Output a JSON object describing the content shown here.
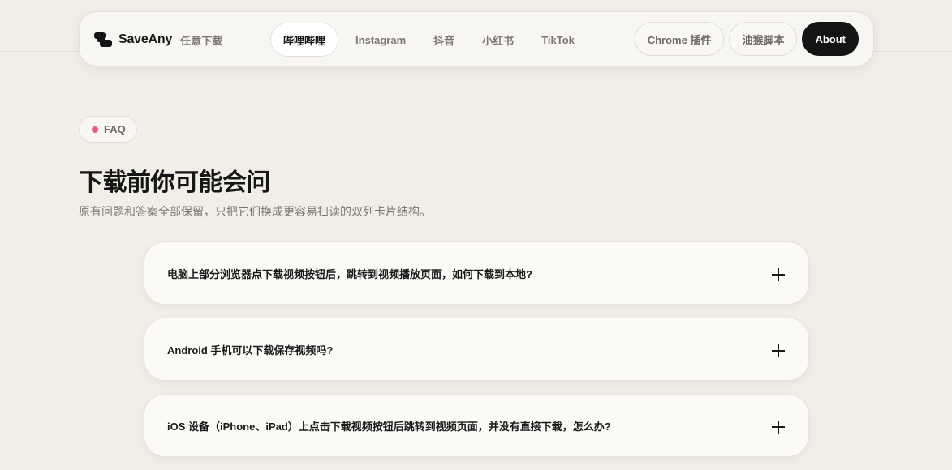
{
  "brand": {
    "name": "SaveAny",
    "subtitle": "任意下载"
  },
  "nav": {
    "tabs": [
      {
        "label": "哔哩哔哩",
        "active": true
      },
      {
        "label": "Instagram",
        "active": false
      },
      {
        "label": "抖音",
        "active": false
      },
      {
        "label": "小红书",
        "active": false
      },
      {
        "label": "TikTok",
        "active": false
      }
    ],
    "chrome_label": "Chrome 插件",
    "script_label": "油猴脚本",
    "about_label": "About"
  },
  "faq_section": {
    "badge": "FAQ",
    "title": "下载前你可能会问",
    "subtitle": "原有问题和答案全部保留，只把它们换成更容易扫读的双列卡片结构。",
    "items": [
      {
        "question": "电脑上部分浏览器点下载视频按钮后，跳转到视频播放页面，如何下载到本地?"
      },
      {
        "question": "Android 手机可以下载保存视频吗?"
      },
      {
        "question": "iOS 设备（iPhone、iPad）上点击下载视频按钮后跳转到视频页面，并没有直接下载，怎么办?"
      }
    ]
  },
  "colors": {
    "background": "#f1eee8",
    "accent_dot": "#ea5b7d",
    "about_button": "#141414"
  },
  "icons": {
    "brand_logo": "saveany-logo-icon",
    "expand": "plus-icon"
  }
}
